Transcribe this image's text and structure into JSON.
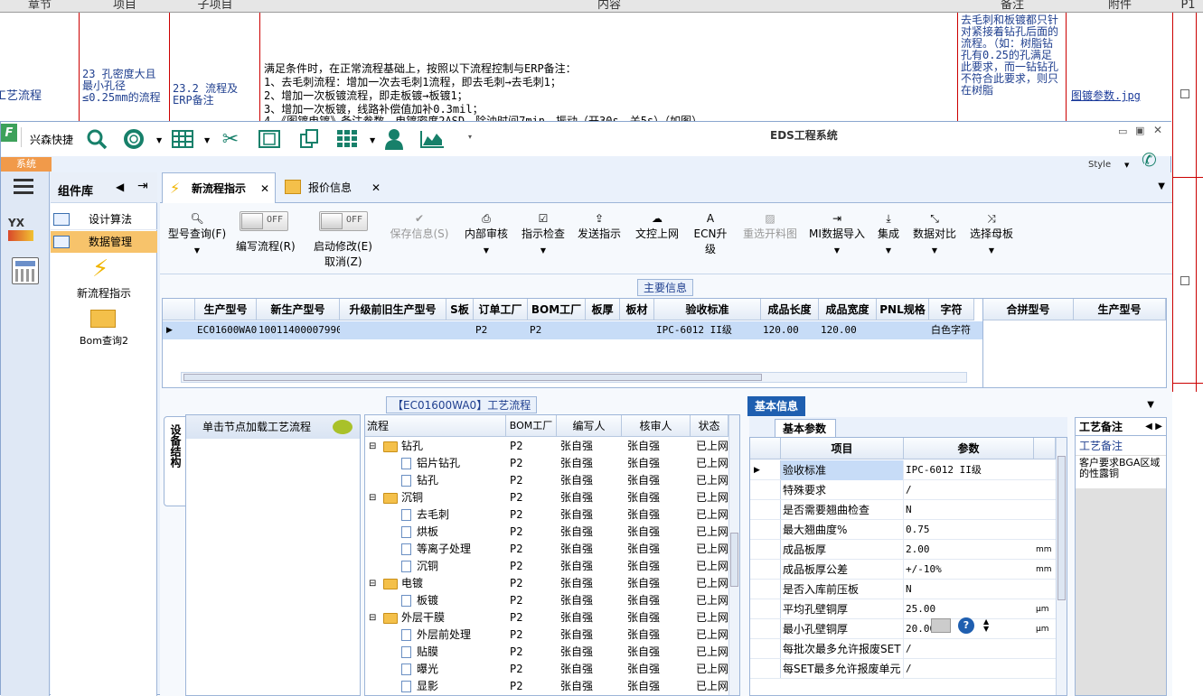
{
  "bg": {
    "headers": [
      "章节",
      "项目",
      "子项目",
      "内容",
      "备注",
      "附件",
      "P1"
    ],
    "chapter": "工艺流程",
    "item": "23 孔密度大且最小孔径≤0.25mm的流程",
    "subitem": "23.2 流程及ERP备注",
    "content_lines": [
      "满足条件时，在正常流程基础上，按照以下流程控制与ERP备注：",
      "1、去毛刺流程：增加一次去毛刺1流程，即去毛刺→去毛刺1；",
      "2、增加一次板镀流程，即走板镀→板镀1；",
      "3、增加一次板镀，线路补偿值加补0.3mil；",
      "4、《图镀电镀》备注参数，电镀密度2ASD，除油时间7min，振动（开30s，关5s）（如图）"
    ],
    "remark": "去毛刺和板镀都只针对紧接着钻孔后面的流程。（如：树脂钻孔有0.25的孔满足此要求，而一钻钻孔不符合此要求，则只在树脂",
    "attachment": "图镀参数.jpg"
  },
  "window": {
    "brand": "兴森快捷",
    "title": "EDS工程系统",
    "style_label": "Style",
    "menu_sys": "系统"
  },
  "library": {
    "title": "组件库",
    "items": [
      "设计算法",
      "数据管理"
    ],
    "tiles": [
      "新流程指示",
      "Bom查询2"
    ]
  },
  "tabs": [
    {
      "label": "新流程指示"
    },
    {
      "label": "报价信息"
    }
  ],
  "toolbar": {
    "model_query": "型号查询(F)",
    "edit_flow": "编写流程(R)",
    "start_edit": "启动修改(E)",
    "cancel": "取消(Z)",
    "save_info": "保存信息(S)",
    "internal_review": "内部审核",
    "instr_check": "指示检查",
    "send_instr": "发送指示",
    "upload": "文控上网",
    "ecn": "ECN升级",
    "reselect": "重选开料图",
    "mi_import": "MI数据导入",
    "integrate": "集成",
    "compare": "数据对比",
    "select_mother": "选择母板",
    "off": "OFF"
  },
  "main_info": {
    "title": "主要信息",
    "columns": [
      "生产型号",
      "新生产型号",
      "升级前旧生产型号",
      "S板",
      "订单工厂",
      "BOM工厂",
      "板厚",
      "板材",
      "验收标准",
      "成品长度",
      "成品宽度",
      "PNL规格",
      "字符"
    ],
    "row": [
      "EC01600WA0",
      "10011400007990",
      "",
      "",
      "P2",
      "P2",
      "",
      "",
      "IPC-6012 II级",
      "120.00",
      "120.00",
      "",
      "白色字符"
    ],
    "side_columns": [
      "合拼型号",
      "生产型号"
    ]
  },
  "flow": {
    "title": "【EC01600WA0】工艺流程",
    "side_tab": "设备结构",
    "node_hint": "单击节点加载工艺流程",
    "columns": [
      "流程",
      "BOM工厂",
      "编写人",
      "核审人",
      "状态"
    ],
    "rows": [
      {
        "name": "钻孔",
        "level": 0,
        "factory": "P2",
        "writer": "张自强",
        "reviewer": "张自强",
        "status": "已上网"
      },
      {
        "name": "铝片钻孔",
        "level": 1,
        "factory": "P2",
        "writer": "张自强",
        "reviewer": "张自强",
        "status": "已上网"
      },
      {
        "name": "钻孔",
        "level": 1,
        "factory": "P2",
        "writer": "张自强",
        "reviewer": "张自强",
        "status": "已上网"
      },
      {
        "name": "沉铜",
        "level": 0,
        "factory": "P2",
        "writer": "张自强",
        "reviewer": "张自强",
        "status": "已上网"
      },
      {
        "name": "去毛刺",
        "level": 1,
        "factory": "P2",
        "writer": "张自强",
        "reviewer": "张自强",
        "status": "已上网"
      },
      {
        "name": "烘板",
        "level": 1,
        "factory": "P2",
        "writer": "张自强",
        "reviewer": "张自强",
        "status": "已上网"
      },
      {
        "name": "等离子处理",
        "level": 1,
        "factory": "P2",
        "writer": "张自强",
        "reviewer": "张自强",
        "status": "已上网"
      },
      {
        "name": "沉铜",
        "level": 1,
        "factory": "P2",
        "writer": "张自强",
        "reviewer": "张自强",
        "status": "已上网"
      },
      {
        "name": "电镀",
        "level": 0,
        "factory": "P2",
        "writer": "张自强",
        "reviewer": "张自强",
        "status": "已上网"
      },
      {
        "name": "板镀",
        "level": 1,
        "factory": "P2",
        "writer": "张自强",
        "reviewer": "张自强",
        "status": "已上网"
      },
      {
        "name": "外层干膜",
        "level": 0,
        "factory": "P2",
        "writer": "张自强",
        "reviewer": "张自强",
        "status": "已上网"
      },
      {
        "name": "外层前处理",
        "level": 1,
        "factory": "P2",
        "writer": "张自强",
        "reviewer": "张自强",
        "status": "已上网"
      },
      {
        "name": "贴膜",
        "level": 1,
        "factory": "P2",
        "writer": "张自强",
        "reviewer": "张自强",
        "status": "已上网"
      },
      {
        "name": "曝光",
        "level": 1,
        "factory": "P2",
        "writer": "张自强",
        "reviewer": "张自强",
        "status": "已上网"
      },
      {
        "name": "显影",
        "level": 1,
        "factory": "P2",
        "writer": "张自强",
        "reviewer": "张自强",
        "status": "已上网"
      }
    ]
  },
  "basic": {
    "title": "基本信息",
    "subtab": "基本参数",
    "columns": [
      "项目",
      "参数"
    ],
    "rows": [
      {
        "item": "验收标准",
        "value": "IPC-6012 II级",
        "unit": ""
      },
      {
        "item": "特殊要求",
        "value": "/",
        "unit": ""
      },
      {
        "item": "是否需要翘曲检查",
        "value": "N",
        "unit": ""
      },
      {
        "item": "最大翘曲度%",
        "value": "0.75",
        "unit": ""
      },
      {
        "item": "成品板厚",
        "value": "2.00",
        "unit": "mm"
      },
      {
        "item": "成品板厚公差",
        "value": "+/-10%",
        "unit": "mm"
      },
      {
        "item": "是否入库前压板",
        "value": "N",
        "unit": ""
      },
      {
        "item": "平均孔壁铜厚",
        "value": "25.00",
        "unit": "μm"
      },
      {
        "item": "最小孔壁铜厚",
        "value": "20.00",
        "unit": "μm"
      },
      {
        "item": "每批次最多允许报废SET",
        "value": "/",
        "unit": ""
      },
      {
        "item": "每SET最多允许报废单元",
        "value": "/",
        "unit": ""
      }
    ]
  },
  "remark_panel": {
    "tab": "工艺备注",
    "header": "工艺备注",
    "text": "客户要求BGA区域的性露铜"
  }
}
